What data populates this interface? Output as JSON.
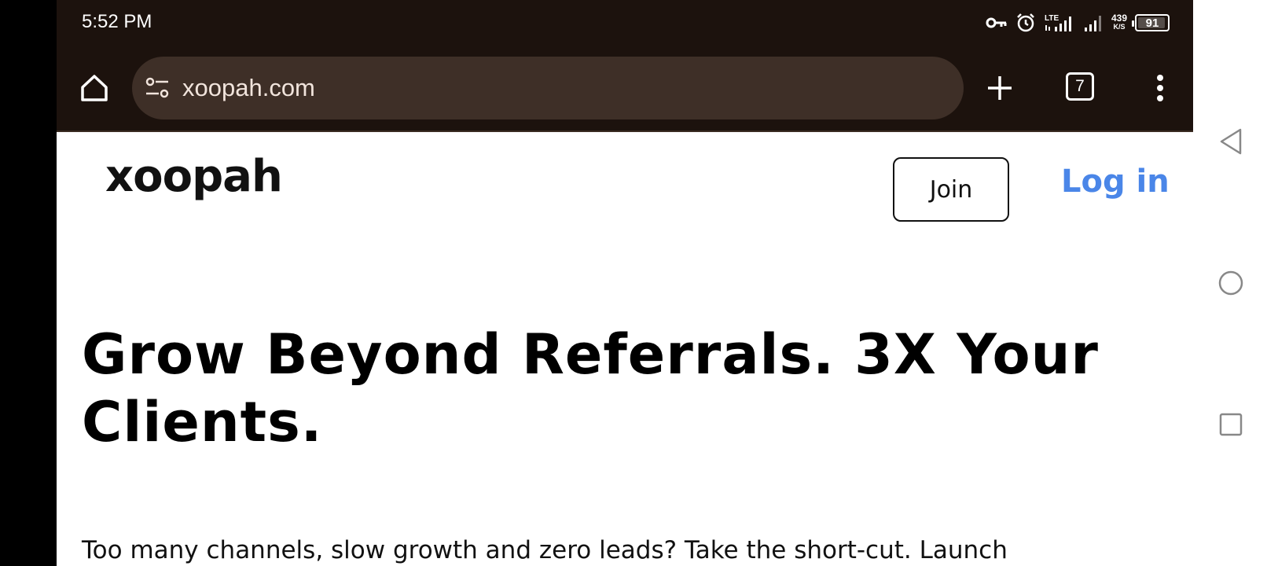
{
  "status_bar": {
    "time": "5:52 PM",
    "speed_value": "439",
    "speed_unit": "K/S",
    "battery": "91",
    "icons": [
      "vpn-key-icon",
      "alarm-icon",
      "lte-signal-icon",
      "signal-icon"
    ]
  },
  "browser": {
    "url": "xoopah.com",
    "tab_count": "7",
    "theme_color": "#1c120d",
    "omnibox_color": "#3e2f27"
  },
  "header": {
    "logo": "xoopah",
    "join_label": "Join",
    "login_label": "Log in",
    "login_color": "#4a86e8"
  },
  "hero": {
    "title": "Grow Beyond Referrals. 3X Your Clients.",
    "body": "Too many channels, slow growth and zero leads? Take the short-cut. Launch"
  },
  "system_nav": {
    "icons": [
      "back-icon",
      "home-circle-icon",
      "recents-icon"
    ]
  }
}
